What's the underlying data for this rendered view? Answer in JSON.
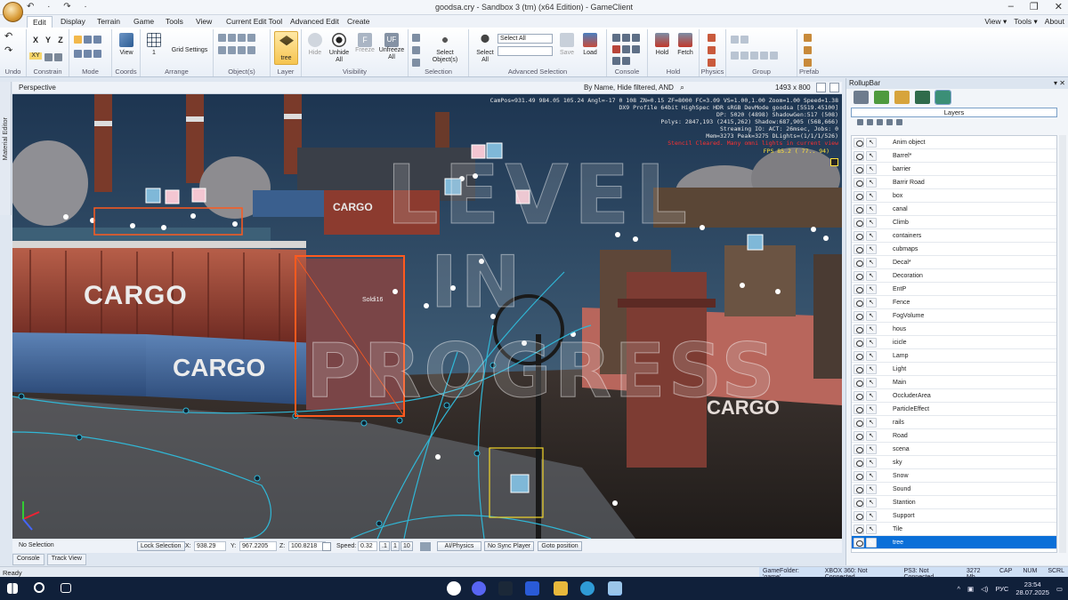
{
  "window": {
    "title": "goodsa.cry - Sandbox 3 (tm) (x64 Edition) - GameClient",
    "controls": [
      "–",
      "❐",
      "✕"
    ]
  },
  "quick_access": "↶ · ↷ ·",
  "menu": {
    "tabs": [
      "Edit",
      "Display",
      "Terrain",
      "Game",
      "Tools",
      "View",
      "Current Edit Tool",
      "Advanced Edit",
      "Create"
    ],
    "right": [
      "View ▾",
      "Tools ▾",
      "About"
    ]
  },
  "ribbon": {
    "groups": [
      "Undo",
      "Constrain",
      "Mode",
      "Coords",
      "Arrange",
      "Object(s)",
      "Layer",
      "Visibility",
      "Selection",
      "Advanced Selection",
      "Console",
      "Hold",
      "Physics",
      "Group",
      "Prefab"
    ],
    "axes": [
      "X",
      "Y",
      "Z",
      "XY"
    ],
    "view_label": "View",
    "arrange_value": "1",
    "grid_settings": "Grid Settings",
    "layer_button": "tree",
    "visibility": [
      "Hide",
      "Unhide All",
      "Freeze",
      "Unfreeze All"
    ],
    "select_objects": "Select Object(s)",
    "select_all_btn": "Select All",
    "select_all_combo": "Select All",
    "save": "Save",
    "load": "Load",
    "hold": "Hold",
    "fetch": "Fetch"
  },
  "viewport": {
    "title": "Perspective",
    "filter": "By Name, Hide filtered, AND",
    "resolution": "1493 x 800",
    "stats": [
      "CamPos=931.49 984.05 105.24 Angl=-17  0 108 ZN=0.15 ZF=8000 FC=3.09 VS=1.00,1.00 Zoom=1.00 Speed=1.38",
      "DX9 Profile 64bit HighSpec HDR sRGB DevMode goodsa [5519.45100]",
      "DP: 5020 (4898) ShadowGen:517 (508)",
      "Polys: 2847,193 (2415,262) Shadow:687,905 (568,666)",
      "Streaming IO: ACT:  26msec, Jobs: 0",
      "Mem=3273 Peak=3275 DLights=(1/1/1/526)"
    ],
    "warning": "Stencil Cleared. Many omni lights in current view",
    "fps": "FPS  85.2 ( 77.. 94)",
    "watermark_line1": "LEVEL",
    "watermark_line2": "IN",
    "watermark_line3": "PROGRESS",
    "object_label": "Soldi16",
    "cargo_text": "CARGO"
  },
  "side_tab": "Material Editor",
  "status_row": {
    "selection": "No Selection",
    "lock": "Lock Selection",
    "x_label": "X:",
    "x": "938.29",
    "y_label": "Y:",
    "y": "967.2205",
    "z_label": "Z:",
    "z": "100.8218",
    "speed_label": "Speed:",
    "speed": "0.32",
    "speed_opts": [
      ".1",
      "1",
      "10"
    ],
    "ai_physics": "AI/Physics",
    "no_sync": "No Sync Player",
    "goto": "Goto position"
  },
  "bottom_tabs": [
    "Console",
    "Track View"
  ],
  "statusbar": {
    "left": "Ready",
    "items": [
      "GameFolder: 'game'",
      "XBOX 360: Not Connected",
      "PS3: Not Connected",
      "3272 Mb",
      "CAP",
      "NUM",
      "SCRL"
    ]
  },
  "rollup": {
    "title": "RollupBar",
    "title_ctrl": "▾ ✕",
    "layers_header": "Layers",
    "layers": [
      "Anim object",
      "Barrel*",
      "barrier",
      "Barrir Road",
      "box",
      "canal",
      "Climb",
      "containers",
      "cubmaps",
      "Decal*",
      "Decoration",
      "EntP",
      "Fence",
      "FogVolume",
      "hous",
      "icicle",
      "Lamp",
      "Light",
      "Main",
      "OccluderArea",
      "ParticleEffect",
      "rails",
      "Road",
      "scena",
      "sky",
      "Snow",
      "Sound",
      "Stantion",
      "Support",
      "Tile",
      "tree"
    ],
    "selected_layer": "tree"
  },
  "taskbar": {
    "lang": "РУС",
    "time": "23:54",
    "date": "28.07.2025"
  }
}
